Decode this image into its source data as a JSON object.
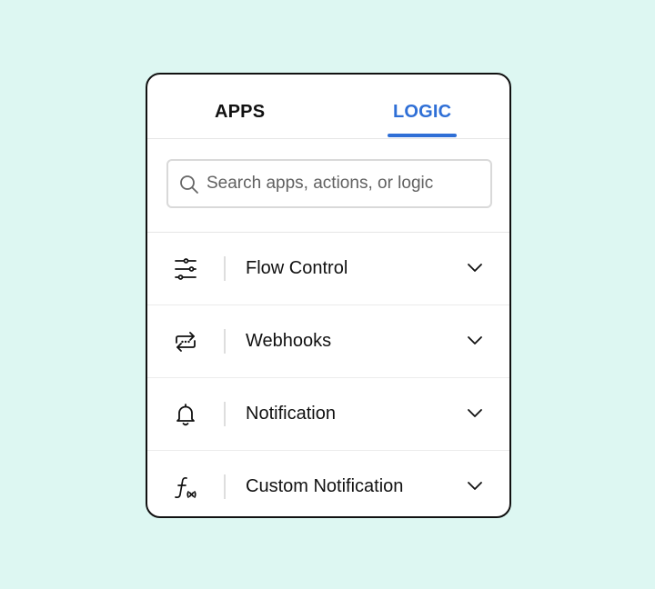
{
  "tabs": {
    "apps_label": "APPS",
    "logic_label": "LOGIC",
    "active": "LOGIC",
    "active_color": "#2f6fd6"
  },
  "search": {
    "placeholder": "Search apps, actions, or logic",
    "value": "",
    "icon": "search-icon"
  },
  "items": [
    {
      "label": "Flow Control",
      "icon": "sliders-icon"
    },
    {
      "label": "Webhooks",
      "icon": "webhook-arrows-icon"
    },
    {
      "label": "Notification",
      "icon": "bell-icon"
    },
    {
      "label": "Custom Notification",
      "icon": "function-icon"
    }
  ],
  "colors": {
    "background": "#ddf7f2",
    "panel_border": "#111111",
    "accent": "#2f6fd6"
  }
}
